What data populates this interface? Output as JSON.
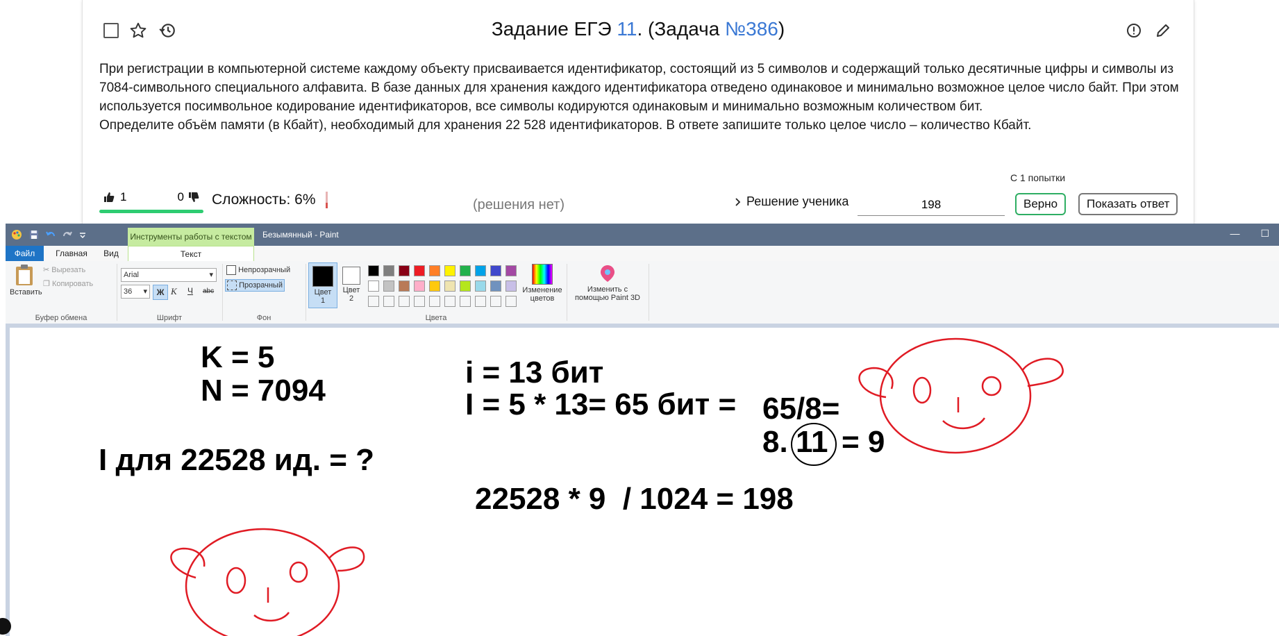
{
  "task": {
    "title_prefix": "Задание ЕГЭ ",
    "task_number": "11",
    "title_mid": ". (Задача ",
    "problem_id": "№386",
    "title_suffix": ")",
    "text_line1": "При регистрации в компьютерной системе каждому объекту присваивается идентификатор, состоящий из 5 символов и содержащий только десятичные цифры и символы из 7084-символьного специального алфавита. В базе данных для хранения каждого идентификатора отведено одинаковое и минимально возможное целое число байт. При этом используется посимвольное кодирование идентификаторов, все символы кодируются одинаковым и минимально возможным количеством бит.",
    "text_line2": "Определите объём памяти (в Кбайт), необходимый для хранения 22 528 идентификаторов. В ответе запишите только целое число – количество Кбайт.",
    "likes": "1",
    "dislikes": "0",
    "difficulty": "Сложность: 6%",
    "no_solution": "(решения нет)",
    "student_solution": "Решение ученика",
    "answer_value": "198",
    "attempts": "С 1 попытки",
    "correct_label": "Верно",
    "show_answer_label": "Показать ответ"
  },
  "paint": {
    "contextual_tab": "Инструменты работы с текстом",
    "window_title": "Безымянный - Paint",
    "tabs": {
      "file": "Файл",
      "main": "Главная",
      "view": "Вид",
      "text": "Текст"
    },
    "ribbon": {
      "paste": "Вставить",
      "cut": "Вырезать",
      "copy": "Копировать",
      "clipboard_group": "Буфер обмена",
      "font_name": "Arial",
      "font_size": "36",
      "bold": "Ж",
      "italic": "К",
      "underline": "Ч",
      "strike": "abc",
      "font_group": "Шрифт",
      "opaque": "Непрозрачный",
      "transparent": "Прозрачный",
      "background_group": "Фон",
      "color1_a": "Цвет",
      "color1_b": "1",
      "color2_a": "Цвет",
      "color2_b": "2",
      "edit_colors_a": "Изменение",
      "edit_colors_b": "цветов",
      "colors_group": "Цвета",
      "paint3d_a": "Изменить с",
      "paint3d_b": "помощью Paint 3D"
    },
    "palette_row1": [
      "#000000",
      "#7f7f7f",
      "#880015",
      "#ed1c24",
      "#ff7f27",
      "#fff200",
      "#22b14c",
      "#00a2e8",
      "#3f48cc",
      "#a349a4"
    ],
    "palette_row2": [
      "#ffffff",
      "#c3c3c3",
      "#b97a57",
      "#ffaec9",
      "#ffc90e",
      "#efe4b0",
      "#b5e61d",
      "#99d9ea",
      "#7092be",
      "#c8bfe7"
    ],
    "canvas": {
      "k": "K = 5",
      "n": "N = 7094",
      "i": "i = 13 бит",
      "big_i": "I = 5 * 13= 65 бит =",
      "div": "65/8=",
      "eight": "8.",
      "eleven": "11",
      "nine": "= 9",
      "question": "I для 22528 ид. = ?",
      "result": "22528 * 9  / 1024 = 198"
    }
  }
}
